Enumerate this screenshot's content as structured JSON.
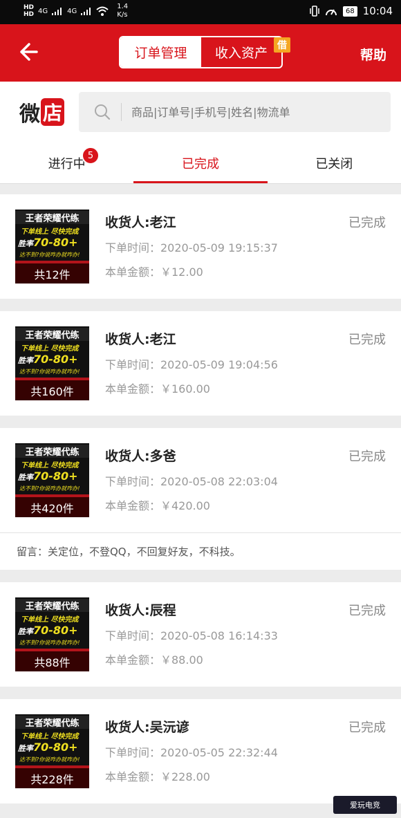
{
  "status_bar": {
    "hd1": "HD",
    "hd2": "HD",
    "net1": "4G",
    "net2": "4G",
    "speed_value": "1.4",
    "speed_unit": "K/s",
    "battery": "68",
    "time": "10:04"
  },
  "header": {
    "tab_orders": "订单管理",
    "tab_income": "收入资产",
    "badge": "借",
    "help": "帮助"
  },
  "logo": {
    "part1": "微",
    "part2": "店"
  },
  "search": {
    "placeholder": "商品|订单号|手机号|姓名|物流单"
  },
  "tabs": [
    {
      "label": "进行中",
      "badge": "5"
    },
    {
      "label": "已完成"
    },
    {
      "label": "已关闭"
    }
  ],
  "thumb": {
    "title": "王者荣耀代练",
    "line1": "下单线上 尽快完成",
    "line2a": "胜率",
    "line2b": "70-80+",
    "line3": "达不到?你说咋办就咋办!"
  },
  "labels": {
    "recipient_prefix": "收货人:",
    "time_prefix": "下单时间：",
    "amount_prefix": "本单金额：",
    "note_prefix": "留言："
  },
  "orders": [
    {
      "count": "共12件",
      "recipient": "收货人:老江",
      "status": "已完成",
      "time": "下单时间：2020-05-09 19:15:37",
      "amount": "本单金额：￥12.00"
    },
    {
      "count": "共160件",
      "recipient": "收货人:老江",
      "status": "已完成",
      "time": "下单时间：2020-05-09 19:04:56",
      "amount": "本单金额：￥160.00"
    },
    {
      "count": "共420件",
      "recipient": "收货人:多爸",
      "status": "已完成",
      "time": "下单时间：2020-05-08 22:03:04",
      "amount": "本单金额：￥420.00",
      "note": "留言：关定位，不登QQ，不回复好友，不科技。"
    },
    {
      "count": "共88件",
      "recipient": "收货人:辰程",
      "status": "已完成",
      "time": "下单时间：2020-05-08 16:14:33",
      "amount": "本单金额：￥88.00"
    },
    {
      "count": "共228件",
      "recipient": "收货人:吴沅谚",
      "status": "已完成",
      "time": "下单时间：2020-05-05 22:32:44",
      "amount": "本单金额：￥228.00"
    }
  ],
  "watermark": "爱玩电竞",
  "colors": {
    "brand_red": "#d8141b",
    "badge_orange": "#f5a623"
  }
}
